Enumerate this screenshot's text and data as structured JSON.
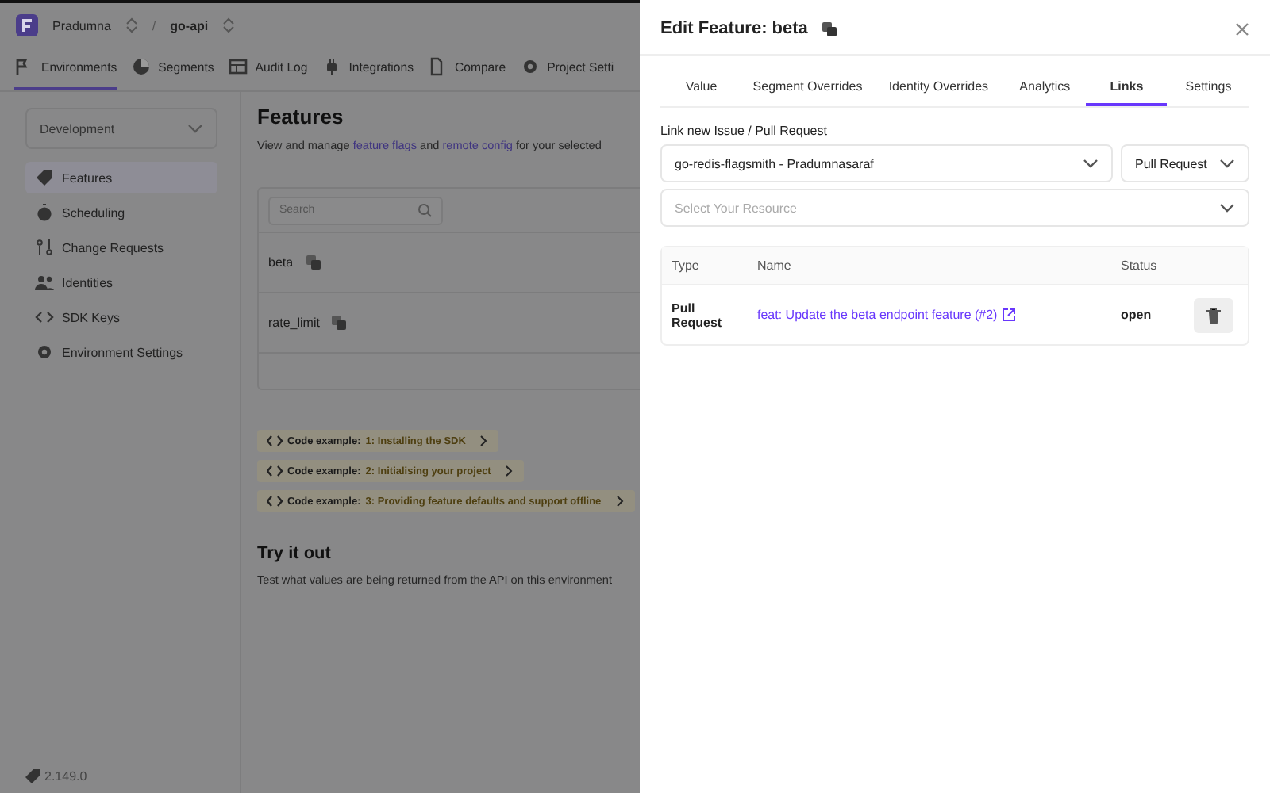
{
  "header": {
    "organisation": "Pradumna",
    "separator": "/",
    "project": "go-api"
  },
  "nav_tabs": [
    {
      "label": "Environments",
      "selected": true
    },
    {
      "label": "Segments",
      "selected": false
    },
    {
      "label": "Audit Log",
      "selected": false
    },
    {
      "label": "Integrations",
      "selected": false
    },
    {
      "label": "Compare",
      "selected": false
    },
    {
      "label": "Project Setti",
      "selected": false
    }
  ],
  "sidebar": {
    "environment": "Development",
    "items": [
      {
        "label": "Features",
        "selected": true
      },
      {
        "label": "Scheduling",
        "selected": false
      },
      {
        "label": "Change Requests",
        "selected": false
      },
      {
        "label": "Identities",
        "selected": false
      },
      {
        "label": "SDK Keys",
        "selected": false
      },
      {
        "label": "Environment Settings",
        "selected": false
      }
    ],
    "version": "2.149.0"
  },
  "features_page": {
    "title": "Features",
    "desc_parts": [
      "View and manage ",
      "feature flags",
      " and ",
      "remote config",
      " for your selected"
    ],
    "search_placeholder": "Search",
    "features": [
      "beta",
      "rate_limit"
    ],
    "code_examples": [
      {
        "label": "Code example:",
        "title": "1: Installing the SDK"
      },
      {
        "label": "Code example:",
        "title": "2: Initialising your project"
      },
      {
        "label": "Code example:",
        "title": "3: Providing feature defaults and support offline"
      }
    ],
    "try_title": "Try it out",
    "try_text": "Test what values are being returned from the API on this environment"
  },
  "modal": {
    "title": "Edit Feature: beta",
    "tabs": [
      {
        "label": "Value",
        "selected": false
      },
      {
        "label": "Segment Overrides",
        "selected": false
      },
      {
        "label": "Identity Overrides",
        "selected": false
      },
      {
        "label": "Analytics",
        "selected": false
      },
      {
        "label": "Links",
        "selected": true
      },
      {
        "label": "Settings",
        "selected": false
      }
    ],
    "link_label": "Link new Issue / Pull Request",
    "repository": "go-redis-flagsmith - Pradumnasaraf",
    "link_type": "Pull Request",
    "resource_placeholder": "Select Your Resource",
    "table": {
      "columns": [
        "Type",
        "Name",
        "Status"
      ],
      "rows": [
        {
          "type": "Pull Request",
          "name": "feat: Update the beta endpoint feature (#2)",
          "status": "open"
        }
      ]
    }
  }
}
